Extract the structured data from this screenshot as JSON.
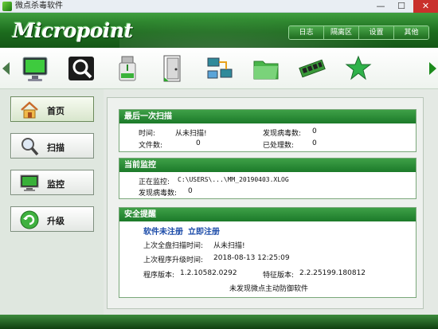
{
  "window": {
    "title": "微点杀毒软件",
    "min_label": "—",
    "max_label": "☐",
    "close_label": "✕"
  },
  "header": {
    "logo_text": "Micropoint",
    "nav": [
      "日志",
      "隔离区",
      "设置",
      "其他"
    ]
  },
  "toolbar": {
    "tools": [
      "monitor-icon",
      "scan-magnifier-icon",
      "usb-drive-icon",
      "file-door-icon",
      "network-computers-icon",
      "folder-icon",
      "memory-module-icon",
      "star-icon"
    ]
  },
  "sidebar": {
    "items": [
      {
        "label": "首页",
        "icon": "home-icon",
        "active": true
      },
      {
        "label": "扫描",
        "icon": "magnifier-icon",
        "active": false
      },
      {
        "label": "监控",
        "icon": "monitor-icon",
        "active": false
      },
      {
        "label": "升级",
        "icon": "refresh-icon",
        "active": false
      }
    ]
  },
  "last_scan": {
    "title": "最后一次扫描",
    "time_label": "时间:",
    "time_value": "从未扫描!",
    "virus_label": "发现病毒数:",
    "virus_value": "0",
    "files_label": "文件数:",
    "files_value": "0",
    "handled_label": "已处理数:",
    "handled_value": "0"
  },
  "monitor": {
    "title": "当前监控",
    "current_label": "正在监控:",
    "current_value": "C:\\USERS\\...\\MM_20190403.XLOG",
    "virus_label": "发现病毒数:",
    "virus_value": "0"
  },
  "security": {
    "title": "安全提醒",
    "unregistered": "软件未注册",
    "register_now": "立即注册",
    "last_full_scan_label": "上次全盘扫描时间:",
    "last_full_scan_value": "从未扫描!",
    "last_upgrade_label": "上次程序升级时间:",
    "last_upgrade_value": "2018-08-13 12:25:09",
    "program_version_label": "程序版本:",
    "program_version_value": "1.2.10582.0292",
    "signature_version_label": "特征版本:",
    "signature_version_value": "2.2.25199.180812",
    "notice": "未发现微点主动防御软件"
  },
  "colors": {
    "header_green": "#1c6c1d",
    "box_header": "#2a8d35",
    "link_blue": "#1a4aa8"
  }
}
